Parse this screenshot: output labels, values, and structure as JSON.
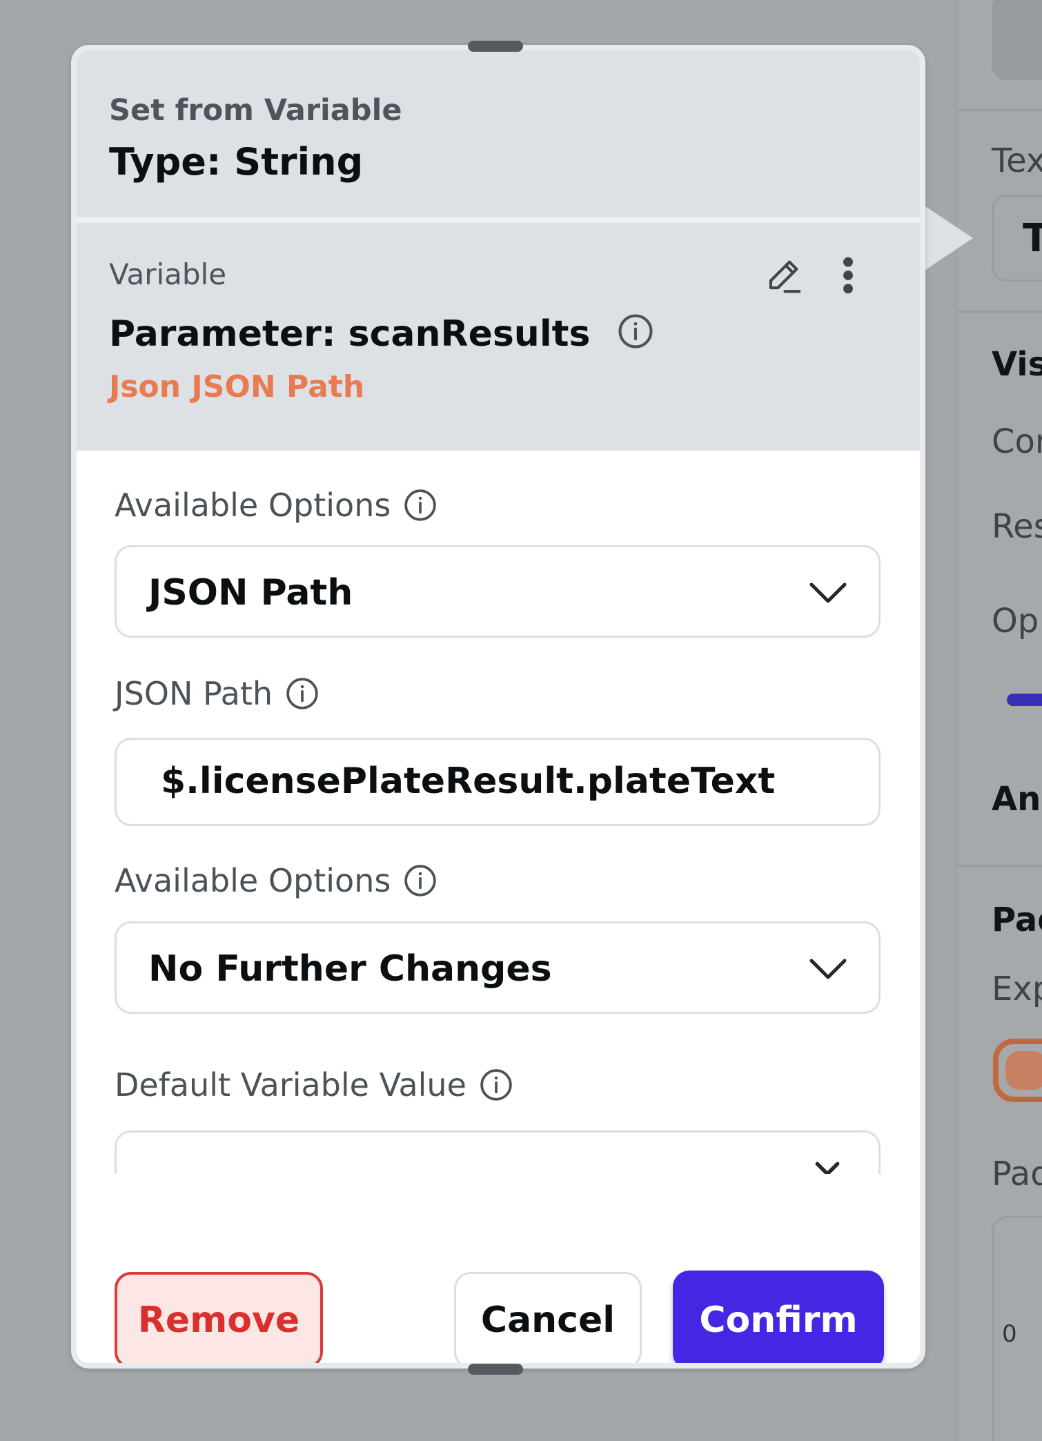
{
  "background_panel": {
    "labels": [
      "Tex",
      "Visi",
      "Cor",
      "Res",
      "Op",
      "Ani",
      "Pad",
      "Exp",
      "Pad"
    ],
    "field_text": "T",
    "field_small_text": "0"
  },
  "popover": {
    "header": {
      "caption": "Set from Variable",
      "type_label": "Type: String"
    },
    "variable": {
      "label": "Variable",
      "name": "Parameter: scanResults",
      "subtitle": "Json JSON Path"
    },
    "fields": {
      "available_options_1": {
        "label": "Available Options",
        "value": "JSON Path"
      },
      "json_path": {
        "label": "JSON Path",
        "value": "$.licensePlateResult.plateText"
      },
      "available_options_2": {
        "label": "Available Options",
        "value": "No Further Changes"
      },
      "default_value": {
        "label": "Default Variable Value",
        "value": ""
      }
    },
    "buttons": {
      "remove": "Remove",
      "cancel": "Cancel",
      "confirm": "Confirm"
    }
  },
  "colors": {
    "accent": "#4527e3",
    "danger": "#d9302e",
    "subtitle_orange": "#e87b4f",
    "header_bg": "#dde1e6"
  },
  "icons": [
    "pencil-icon",
    "more-vertical-icon",
    "info-icon",
    "chevron-down-icon",
    "close-icon"
  ]
}
